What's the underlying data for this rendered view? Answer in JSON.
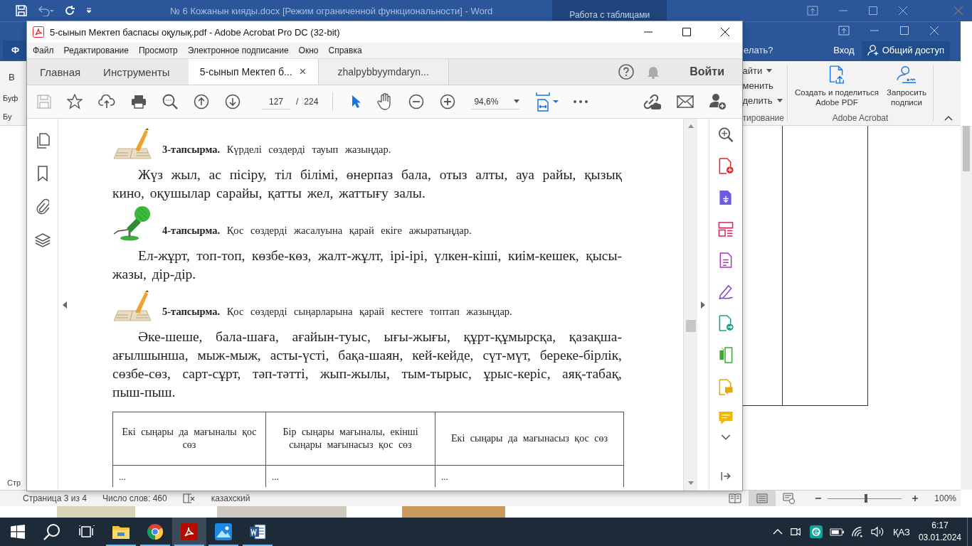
{
  "word_back": {
    "title": "№ 6 Кожанын кияды.docx [Режим ограниченной функциональности] - Word",
    "context_tab": "Работа с таблицами"
  },
  "word": {
    "file_tab": "Ф",
    "tell_me": "елать?",
    "sign_in": "Вход",
    "share": "Общий доступ",
    "left_labels": [
      "В",
      "Буф",
      "Бу"
    ],
    "ribbon_items": [
      {
        "label": "айти",
        "dropdown": true
      },
      {
        "label": "менить",
        "dropdown": false
      },
      {
        "label": "делить",
        "dropdown": true
      }
    ],
    "group_label": "тирование",
    "acrobat_buttons": [
      {
        "label": "Создать и поделиться Adobe PDF",
        "kind": "create"
      },
      {
        "label": "Запросить подписи",
        "kind": "sign"
      }
    ],
    "acrobat_group": "Adobe Acrobat",
    "side_label": "Стр",
    "status": {
      "page": "Страница 3 из 4",
      "words": "Число слов: 460",
      "language": "казахский",
      "views": [
        {
          "kind": "read",
          "selected": false
        },
        {
          "kind": "print",
          "selected": true
        },
        {
          "kind": "web",
          "selected": false
        }
      ],
      "zoom": {
        "level": 0.52,
        "reading": "100%"
      }
    }
  },
  "acrobat": {
    "title": "5-сынып Мектеп баспасы оқулық.pdf - Adobe Acrobat Pro DC (32-bit)",
    "menu": [
      "Файл",
      "Редактирование",
      "Просмотр",
      "Электронное подписание",
      "Окно",
      "Справка"
    ],
    "tabs": [
      {
        "label": "Главная",
        "kind": "nav",
        "selected": false
      },
      {
        "label": "Инструменты",
        "kind": "nav",
        "selected": false
      },
      {
        "label": "5-сынып Мектеп б...",
        "kind": "doc",
        "selected": true,
        "close_label": "×"
      },
      {
        "label": "zhalpybbyymdaryn...",
        "kind": "doc",
        "selected": false
      }
    ],
    "sign_in": "Войти",
    "page_current": "127",
    "page_separator": "/",
    "page_total": "224",
    "zoom": "94,6%",
    "page": {
      "tasks": [
        {
          "kind": "book",
          "heading": "**3-тапсырма.** Күрделі сөздерді тауып жазыңдар.",
          "text": "Жүз жыл, ас пісіру, тіл білімі, өнерпаз бала, отыз алты, ауа райы, қызық кино, оқушылар сарайы, қатты жел, жаттығу залы."
        },
        {
          "kind": "microphone",
          "heading": "**4-тапсырма.** Қос сөздерді жасалуына қарай екіге ажыратыңдар.",
          "text": "Ел-жұрт, топ-топ, көзбе-көз, жалт-жұлт, ірі-ірі, үлкен-кіші, киім-кешек, қысы-жазы, дір-дір."
        },
        {
          "kind": "book",
          "heading": "**5-тапсырма.** Қос сөздерді сыңарларына қарай кестеге топтап жазыңдар.",
          "text": "Әке-шеше, бала-шаға, ағайын-туыс, ығы-жығы, құрт-құмырсқа, қазақша-ағылшынша, мыж-мыж, асты-үсті, бақа-шаян, кей-кейде, сүт-мүт, береке-бірлік, сөзбе-сөз, сарт-сұрт, тәп-тәтті, жып-жылы, тым-тырыс, ұрыс-керіс, аяқ-табақ, пыш-пыш."
        }
      ],
      "table": {
        "columns": [
          "Екі сыңары да мағыналы қос сөз",
          "Бір сыңары мағыналы, екінші сыңары мағынасыз қос сөз",
          "Екі сыңары да мағынасыз қос сөз"
        ],
        "rows": [
          [
            "...",
            "...",
            "..."
          ]
        ]
      }
    }
  },
  "taskbar": {
    "apps": [
      {
        "kind": "explorer",
        "selected": false,
        "running": true
      },
      {
        "kind": "chrome",
        "selected": false,
        "running": true
      },
      {
        "kind": "acrobat",
        "selected": true,
        "running": true
      },
      {
        "kind": "photos",
        "selected": false,
        "running": true
      },
      {
        "kind": "word",
        "selected": false,
        "running": true
      }
    ],
    "tray": {
      "language": "ҚАЗ",
      "time": "6:17",
      "date": "03.01.2024"
    }
  }
}
